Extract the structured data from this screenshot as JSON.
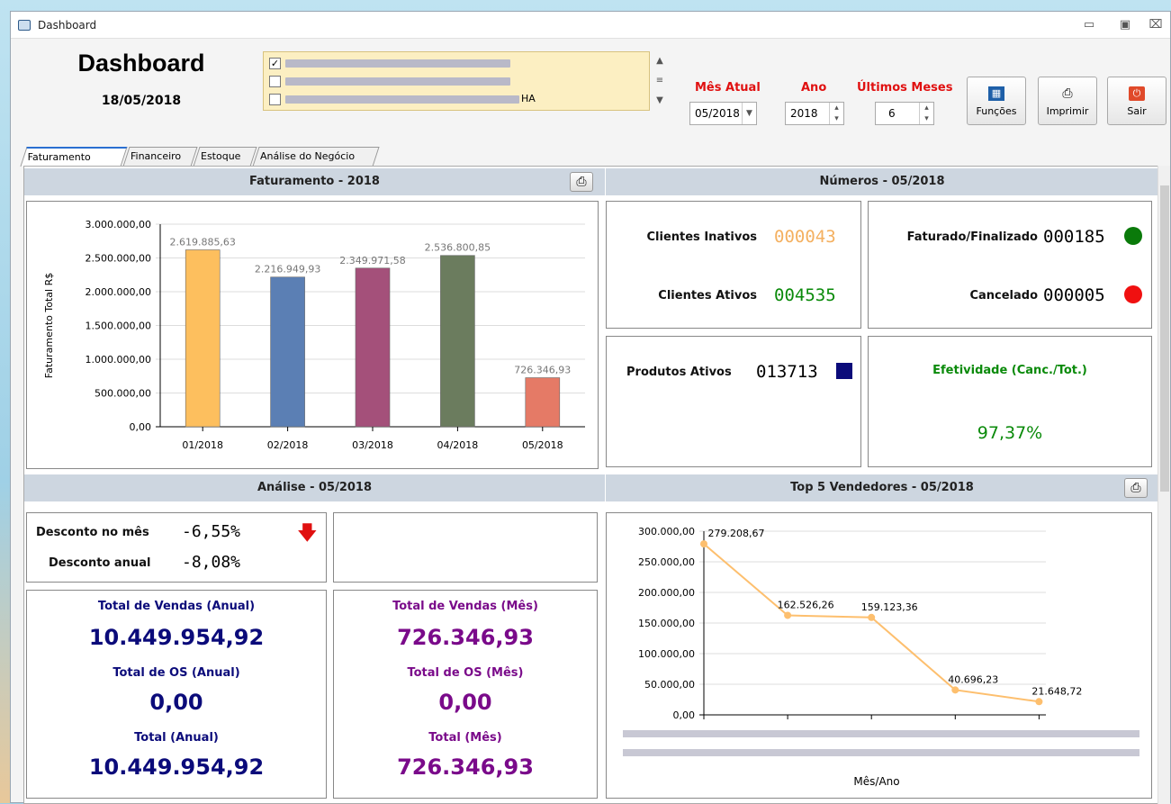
{
  "window": {
    "title": "Dashboard"
  },
  "header": {
    "title": "Dashboard",
    "date": "18/05/2018"
  },
  "companies": [
    {
      "checked": true,
      "suffix": ""
    },
    {
      "checked": false,
      "suffix": ""
    },
    {
      "checked": false,
      "suffix": "HA"
    }
  ],
  "filters": {
    "mes_label": "Mês Atual",
    "mes_value": "05/2018",
    "ano_label": "Ano",
    "ano_value": "2018",
    "ultimos_label": "Últimos Meses",
    "ultimos_value": "6"
  },
  "toolbar": {
    "funcoes": "Funções",
    "imprimir": "Imprimir",
    "sair": "Sair"
  },
  "tabs": [
    "Faturamento",
    "Financeiro",
    "Estoque",
    "Análise do Negócio"
  ],
  "sections": {
    "faturamento": "Faturamento - 2018",
    "numeros": "Números - 05/2018",
    "analise": "Análise - 05/2018",
    "top5": "Top 5 Vendedores - 05/2018"
  },
  "numeros": {
    "clientes_inativos_label": "Clientes Inativos",
    "clientes_inativos": "000043",
    "clientes_ativos_label": "Clientes Ativos",
    "clientes_ativos": "004535",
    "faturado_label": "Faturado/Finalizado",
    "faturado": "000185",
    "cancelado_label": "Cancelado",
    "cancelado": "000005",
    "produtos_label": "Produtos Ativos",
    "produtos": "013713",
    "efetividade_label": "Efetividade (Canc./Tot.)",
    "efetividade": "97,37%"
  },
  "colors": {
    "green": "#0a8a0a",
    "orange": "#f0a040",
    "navy": "#0b0b7a",
    "purple": "#7a0a8a",
    "red": "#e01010"
  },
  "analise": {
    "desconto_mes_label": "Desconto no mês",
    "desconto_mes": "-6,55%",
    "desconto_anual_label": "Desconto anual",
    "desconto_anual": "-8,08%",
    "vendas_anual_label": "Total de Vendas (Anual)",
    "vendas_anual": "10.449.954,92",
    "os_anual_label": "Total de OS (Anual)",
    "os_anual": "0,00",
    "total_anual_label": "Total (Anual)",
    "total_anual": "10.449.954,92",
    "vendas_mes_label": "Total de Vendas (Mês)",
    "vendas_mes": "726.346,93",
    "os_mes_label": "Total de OS (Mês)",
    "os_mes": "0,00",
    "total_mes_label": "Total (Mês)",
    "total_mes": "726.346,93"
  },
  "chart_data": [
    {
      "type": "bar",
      "title": "",
      "ylabel": "Faturamento Total R$",
      "xlabel": "",
      "categories": [
        "01/2018",
        "02/2018",
        "03/2018",
        "04/2018",
        "05/2018"
      ],
      "values": [
        2619885.63,
        2216949.93,
        2349971.58,
        2536800.85,
        726346.93
      ],
      "value_labels": [
        "2.619.885,63",
        "2.216.949,93",
        "2.349.971,58",
        "2.536.800,85",
        "726.346,93"
      ],
      "bar_colors": [
        "#fdbf5e",
        "#5b7fb4",
        "#a4507a",
        "#6b7c5e",
        "#e57a66"
      ],
      "ylim": [
        0,
        3000000
      ],
      "yticks": [
        "0,00",
        "500.000,00",
        "1.000.000,00",
        "1.500.000,00",
        "2.000.000,00",
        "2.500.000,00",
        "3.000.000,00"
      ],
      "grid": true
    },
    {
      "type": "line",
      "title": "",
      "xlabel": "Mês/Ano",
      "ylabel": "",
      "values": [
        279208.67,
        162526.26,
        159123.36,
        40696.23,
        21648.72
      ],
      "value_labels": [
        "279.208,67",
        "162.526,26",
        "159.123,36",
        "40.696,23",
        "21.648,72"
      ],
      "ylim": [
        0,
        300000
      ],
      "yticks": [
        "0,00",
        "50.000,00",
        "100.000,00",
        "150.000,00",
        "200.000,00",
        "250.000,00",
        "300.000,00"
      ],
      "line_color": "#fdbf6e",
      "grid": true
    }
  ]
}
